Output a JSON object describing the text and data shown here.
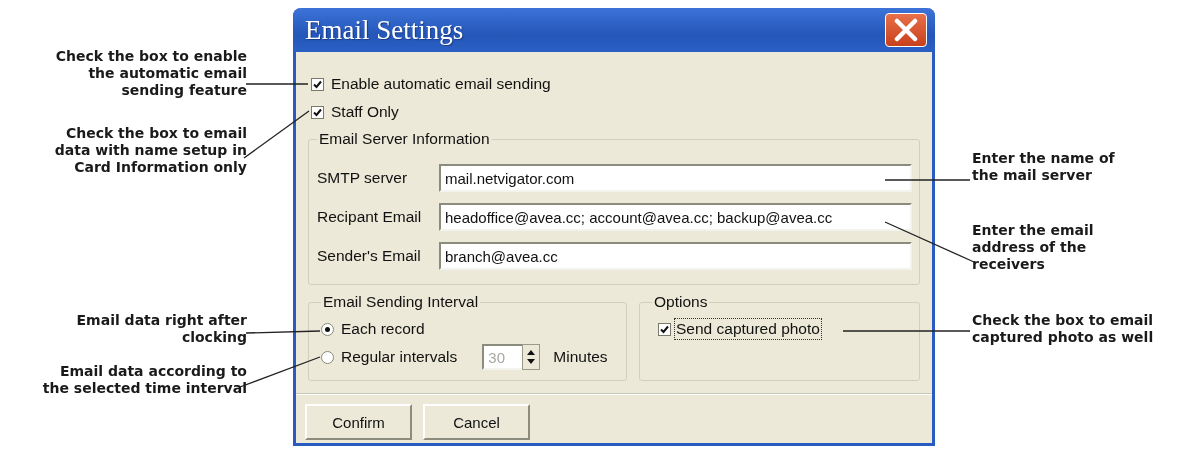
{
  "window": {
    "title": "Email Settings"
  },
  "top_options": [
    {
      "label": "Enable automatic email sending",
      "checked": true
    },
    {
      "label": "Staff Only",
      "checked": true
    }
  ],
  "server_group": {
    "title": "Email Server Information",
    "fields": [
      {
        "label": "SMTP server",
        "value": "mail.netvigator.com"
      },
      {
        "label": "Recipant Email",
        "value": "headoffice@avea.cc; account@avea.cc; backup@avea.cc"
      },
      {
        "label": "Sender's Email",
        "value": "branch@avea.cc"
      }
    ]
  },
  "interval_group": {
    "title": "Email Sending Interval",
    "choices": [
      {
        "label": "Each record",
        "selected": true
      },
      {
        "label": "Regular intervals",
        "selected": false
      }
    ],
    "spinner": {
      "value": "30",
      "disabled": true
    },
    "unit": "Minutes"
  },
  "options_group": {
    "title": "Options",
    "checkbox": {
      "label": "Send captured photo",
      "checked": true,
      "focused": true
    }
  },
  "buttons": [
    "Confirm",
    "Cancel"
  ],
  "annotations_left": [
    "Check the box to enable\nthe automatic email\nsending feature",
    "Check the box to email\ndata with name setup in\nCard Information only",
    "Email data right after\nclocking",
    "Email data according to\nthe selected time interval"
  ],
  "annotations_right": [
    "Enter the name of\nthe mail server",
    "Enter the email\naddress of the\nreceivers",
    "Check the box to email\ncaptured photo as well"
  ]
}
